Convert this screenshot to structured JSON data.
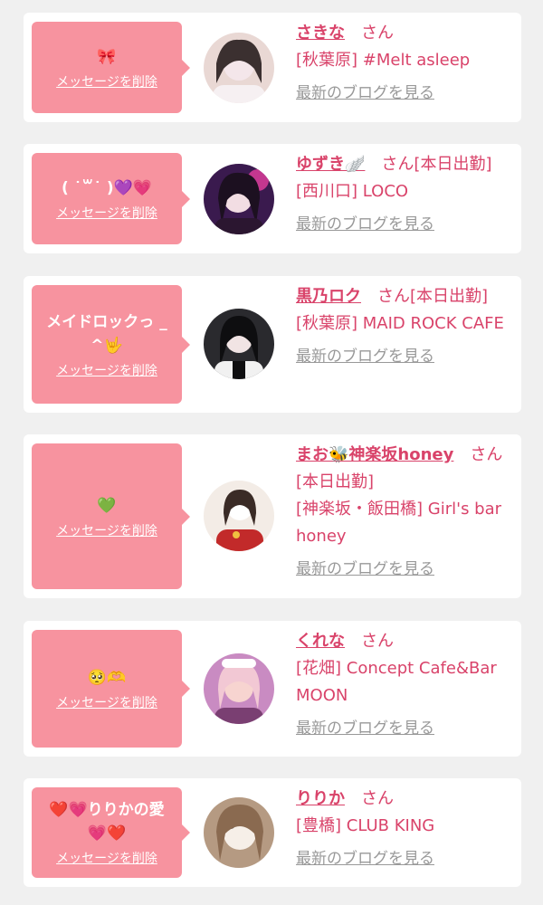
{
  "cards": [
    {
      "message": "🎀",
      "delete_label": "メッセージを削除",
      "name": "さきな",
      "san": "さん",
      "shop": "[秋葉原] #Melt asleep",
      "blog_label": "最新のブログを見る",
      "avatar_colors": [
        "#e9d8d4",
        "#3b3030",
        "#f4e6ea"
      ]
    },
    {
      "message": "( ˙꒳˙ )💜💗",
      "delete_label": "メッセージを削除",
      "name": "ゆずき🪽",
      "san": "さん[本日出勤]",
      "shop": "[西川口] LOCO",
      "blog_label": "最新のブログを見る",
      "avatar_colors": [
        "#3a1a4e",
        "#1c1020",
        "#e63fa0"
      ]
    },
    {
      "message": "メイドロックっ _ ^🤟",
      "delete_label": "メッセージを削除",
      "name": "黒乃ロク",
      "san": "さん[本日出勤]",
      "shop": "[秋葉原] MAID ROCK CAFE",
      "blog_label": "最新のブログを見る",
      "avatar_colors": [
        "#2a2a2e",
        "#0e0e10",
        "#f1f1f1"
      ]
    },
    {
      "message": "💚",
      "delete_label": "メッセージを削除",
      "name": "まお🐝神楽坂honey",
      "san": "さん[本日出勤]",
      "shop": "[神楽坂・飯田橋] Girl's bar honey",
      "blog_label": "最新のブログを見る",
      "avatar_colors": [
        "#f3ece6",
        "#c22a2a",
        "#3a2b26"
      ]
    },
    {
      "message": "🥺🫶",
      "delete_label": "メッセージを削除",
      "name": "くれな",
      "san": "さん",
      "shop": "[花畑] Concept Cafe&Bar MOON",
      "blog_label": "最新のブログを見る",
      "avatar_colors": [
        "#c98bc2",
        "#f7d4d0",
        "#7a3f72"
      ]
    },
    {
      "message": "❤️💗りりかの愛💗❤️",
      "delete_label": "メッセージを削除",
      "name": "りりか",
      "san": "さん",
      "shop": "[豊橋] CLUB KING",
      "blog_label": "最新のブログを見る",
      "avatar_colors": [
        "#b59a82",
        "#f6efe8",
        "#3c2e25"
      ]
    }
  ]
}
